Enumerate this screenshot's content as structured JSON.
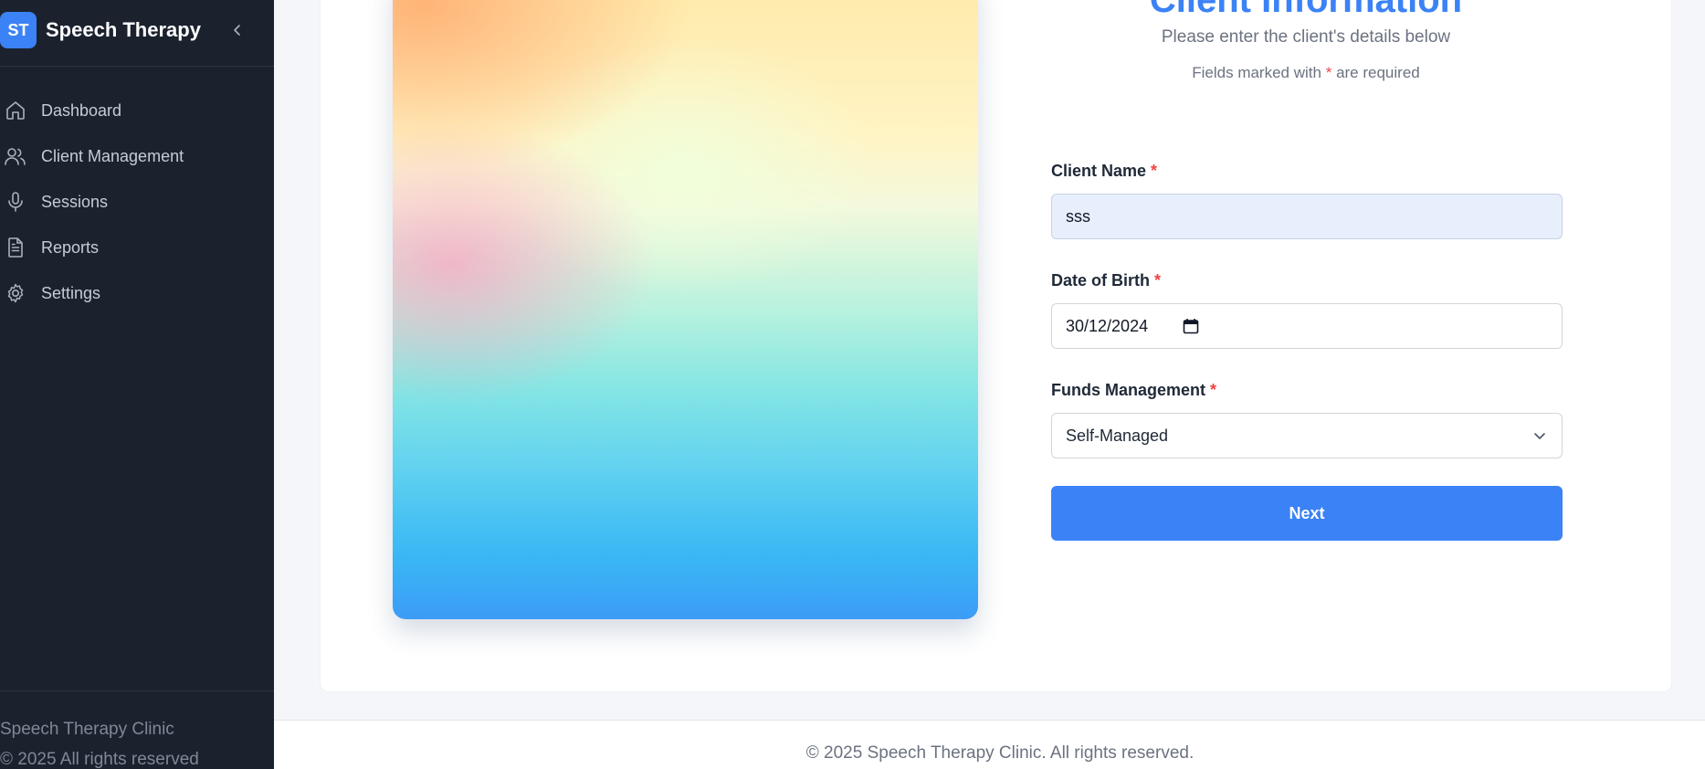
{
  "sidebar": {
    "brand_badge": "ST",
    "brand_name": "Speech Therapy",
    "items": [
      {
        "label": "Dashboard",
        "icon": "home-icon"
      },
      {
        "label": "Client Management",
        "icon": "users-icon"
      },
      {
        "label": "Sessions",
        "icon": "microphone-icon"
      },
      {
        "label": "Reports",
        "icon": "document-icon"
      },
      {
        "label": "Settings",
        "icon": "gear-icon"
      }
    ],
    "footer_line1": "Speech Therapy Clinic",
    "footer_line2": "© 2025 All rights reserved"
  },
  "form": {
    "title": "Client Information",
    "subtitle": "Please enter the client's details below",
    "required_note_prefix": "Fields marked with",
    "required_star": "*",
    "required_note_suffix": "are required",
    "client_name_label": "Client Name",
    "client_name_value": "sss",
    "dob_label": "Date of Birth",
    "dob_value": "30/12/2024",
    "funds_label": "Funds Management",
    "funds_value": "Self-Managed",
    "next_label": "Next"
  },
  "footer": {
    "text": "© 2025 Speech Therapy Clinic. All rights reserved."
  },
  "colors": {
    "accent": "#3b82f6",
    "sidebar_bg": "#1b222e",
    "required": "#ef4444"
  }
}
